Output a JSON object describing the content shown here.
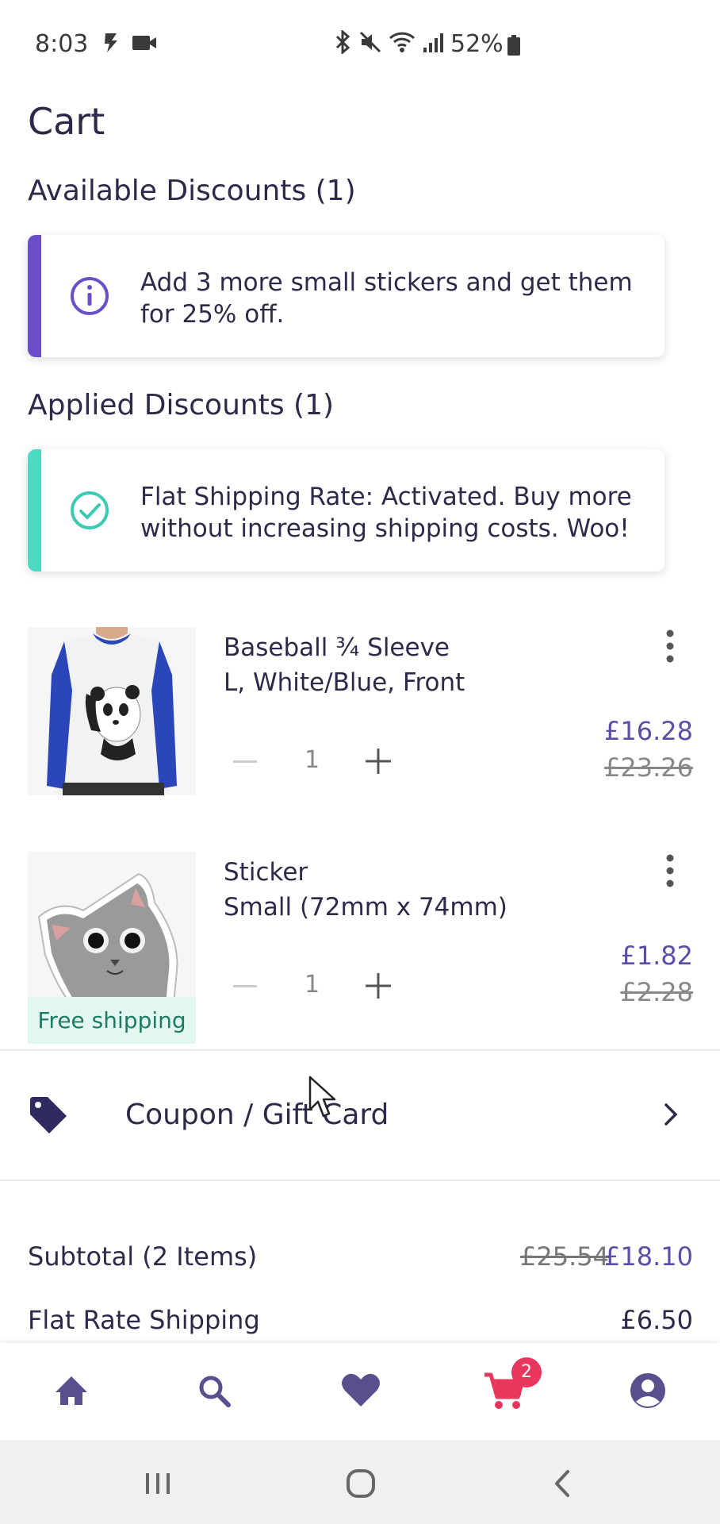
{
  "status_bar": {
    "time": "8:03",
    "battery": "52%"
  },
  "page": {
    "title": "Cart"
  },
  "available": {
    "heading": "Available Discounts (1)",
    "notice": "Add 3 more small stickers and get them for 25% off.",
    "accent": "#6a4fc8"
  },
  "applied": {
    "heading": "Applied Discounts (1)",
    "notice": "Flat Shipping Rate: Activated. Buy more without increasing shipping costs. Woo!",
    "accent": "#4dd9c4"
  },
  "items": [
    {
      "name": "Baseball ¾ Sleeve",
      "variant": "L, White/Blue, Front",
      "quantity": "1",
      "price": "£16.28",
      "original_price": "£23.26"
    },
    {
      "name": "Sticker",
      "variant": "Small (72mm x 74mm)",
      "quantity": "1",
      "price": "£1.82",
      "original_price": "£2.28",
      "badge": "Free shipping"
    }
  ],
  "coupon": {
    "label": "Coupon / Gift Card"
  },
  "summary": {
    "subtotal_label": "Subtotal (2 Items)",
    "subtotal_original": "£25.54",
    "subtotal": "£18.10",
    "shipping_label": "Flat Rate Shipping",
    "shipping": "£6.50"
  },
  "bottom_nav": {
    "items": [
      "home-icon",
      "search-icon",
      "heart-icon",
      "cart-icon",
      "account-icon"
    ],
    "cart_count": "2",
    "active_color": "#e8365d",
    "icon_color": "#5a4f8c"
  }
}
